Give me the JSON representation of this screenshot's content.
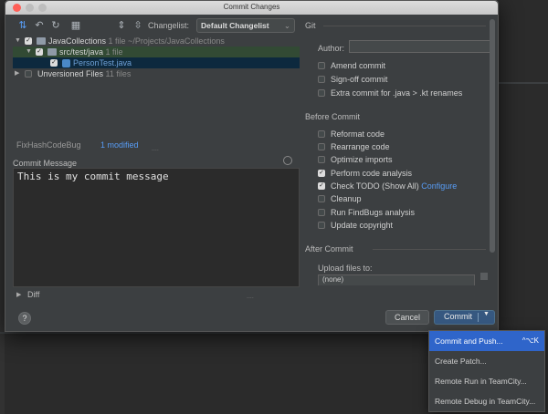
{
  "window": {
    "title": "Commit Changes"
  },
  "toolbar": {
    "changelist_label": "Changelist:",
    "changelist_value": "Default Changelist"
  },
  "tree": {
    "root_name": "JavaCollections",
    "root_meta": "1 file  ~/Projects/JavaCollections",
    "folder_name": "src/test/java",
    "folder_meta": "1 file",
    "file_name": "PersonTest.java",
    "unversioned_name": "Unversioned Files",
    "unversioned_meta": "11 files"
  },
  "status": {
    "branch": "FixHashCodeBug",
    "modified": "1 modified"
  },
  "commit": {
    "label": "Commit Message",
    "message": "This is my commit message"
  },
  "diff": {
    "label": "Diff"
  },
  "git": {
    "section": "Git",
    "author_label": "Author:",
    "options": [
      "Amend commit",
      "Sign-off commit",
      "Extra commit for .java > .kt renames"
    ]
  },
  "before_commit": {
    "section": "Before Commit",
    "options": [
      {
        "label": "Reformat code",
        "checked": false
      },
      {
        "label": "Rearrange code",
        "checked": false
      },
      {
        "label": "Optimize imports",
        "checked": false
      },
      {
        "label": "Perform code analysis",
        "checked": true
      },
      {
        "label": "Check TODO (Show All)",
        "checked": true,
        "link": "Configure"
      },
      {
        "label": "Cleanup",
        "checked": false
      },
      {
        "label": "Run FindBugs analysis",
        "checked": false
      },
      {
        "label": "Update copyright",
        "checked": false
      }
    ]
  },
  "after_commit": {
    "section": "After Commit",
    "upload_label": "Upload files to:",
    "upload_value": "(none)"
  },
  "buttons": {
    "help": "?",
    "cancel": "Cancel",
    "commit": "Commit"
  },
  "menu": {
    "items": [
      {
        "label": "Commit and Push...",
        "shortcut": "^⌥K",
        "active": true
      },
      {
        "label": "Create Patch...",
        "shortcut": ""
      },
      {
        "label": "Remote Run in TeamCity...",
        "shortcut": ""
      },
      {
        "label": "Remote Debug in TeamCity...",
        "shortcut": ""
      }
    ]
  },
  "colors": {
    "accent": "#365880",
    "menu_highlight": "#2f65ca",
    "link": "#589df6"
  }
}
